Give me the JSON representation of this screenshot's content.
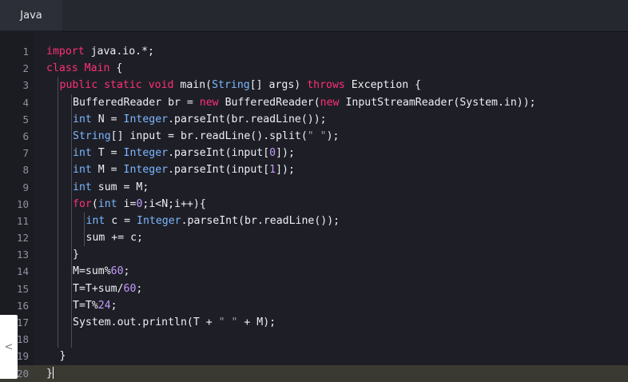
{
  "tabs": [
    {
      "label": "Java"
    }
  ],
  "line_numbers": [
    "1",
    "2",
    "3",
    "4",
    "5",
    "6",
    "7",
    "8",
    "9",
    "10",
    "11",
    "12",
    "13",
    "14",
    "15",
    "16",
    "17",
    "18",
    "19",
    "20"
  ],
  "code": [
    [
      [
        "k",
        "import"
      ],
      [
        "w",
        " java.io.*;"
      ]
    ],
    [
      [
        "k",
        "class"
      ],
      [
        "w",
        " "
      ],
      [
        "k",
        "Main"
      ],
      [
        "w",
        " {"
      ]
    ],
    [
      [
        "k",
        "public"
      ],
      [
        "w",
        " "
      ],
      [
        "k",
        "static"
      ],
      [
        "w",
        " "
      ],
      [
        "k",
        "void"
      ],
      [
        "w",
        " main("
      ],
      [
        "t",
        "String"
      ],
      [
        "w",
        "[] args) "
      ],
      [
        "k",
        "throws"
      ],
      [
        "w",
        " Exception {"
      ]
    ],
    [
      [
        "w",
        "BufferedReader br = "
      ],
      [
        "k",
        "new"
      ],
      [
        "w",
        " BufferedReader("
      ],
      [
        "k",
        "new"
      ],
      [
        "w",
        " InputStreamReader(System.in));"
      ]
    ],
    [
      [
        "t",
        "int"
      ],
      [
        "w",
        " N = "
      ],
      [
        "t",
        "Integer"
      ],
      [
        "w",
        ".parseInt(br.readLine());"
      ]
    ],
    [
      [
        "t",
        "String"
      ],
      [
        "w",
        "[] input = br.readLine().split("
      ],
      [
        "d",
        "\" \""
      ],
      [
        "w",
        ");"
      ]
    ],
    [
      [
        "t",
        "int"
      ],
      [
        "w",
        " T = "
      ],
      [
        "t",
        "Integer"
      ],
      [
        "w",
        ".parseInt(input["
      ],
      [
        "n",
        "0"
      ],
      [
        "w",
        "]);"
      ]
    ],
    [
      [
        "t",
        "int"
      ],
      [
        "w",
        " M = "
      ],
      [
        "t",
        "Integer"
      ],
      [
        "w",
        ".parseInt(input["
      ],
      [
        "n",
        "1"
      ],
      [
        "w",
        "]);"
      ]
    ],
    [
      [
        "t",
        "int"
      ],
      [
        "w",
        " sum = M;"
      ]
    ],
    [
      [
        "k",
        "for"
      ],
      [
        "w",
        "("
      ],
      [
        "t",
        "int"
      ],
      [
        "w",
        " i="
      ],
      [
        "n",
        "0"
      ],
      [
        "w",
        ";i<N;i++){"
      ]
    ],
    [
      [
        "t",
        "int"
      ],
      [
        "w",
        " c = "
      ],
      [
        "t",
        "Integer"
      ],
      [
        "w",
        ".parseInt(br.readLine());"
      ]
    ],
    [
      [
        "w",
        "sum += c;"
      ]
    ],
    [
      [
        "w",
        "}"
      ]
    ],
    [
      [
        "w",
        "M=sum%"
      ],
      [
        "n",
        "60"
      ],
      [
        "w",
        ";"
      ]
    ],
    [
      [
        "w",
        "T=T+sum/"
      ],
      [
        "n",
        "60"
      ],
      [
        "w",
        ";"
      ]
    ],
    [
      [
        "w",
        "T=T%"
      ],
      [
        "n",
        "24"
      ],
      [
        "w",
        ";"
      ]
    ],
    [
      [
        "w",
        "System.out.println(T + "
      ],
      [
        "d",
        "\" \""
      ],
      [
        "w",
        " + M);"
      ]
    ],
    [],
    [
      [
        "w",
        "}"
      ]
    ],
    [
      [
        "w",
        "}"
      ]
    ]
  ],
  "side_tab": {
    "icon": "chevron-left-icon",
    "glyph": "<"
  }
}
